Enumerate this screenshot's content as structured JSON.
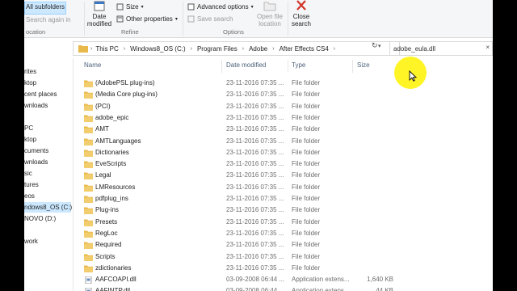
{
  "ribbon": {
    "all_subfolders": "All subfolders",
    "search_again_in": "Search again in",
    "location_group": "ocation",
    "date_modified": "Date\nmodified",
    "size": "Size",
    "other_properties": "Other properties",
    "refine_group": "Refine",
    "advanced_options": "Advanced options",
    "save_search": "Save search",
    "open_file_location": "Open file\nlocation",
    "options_group": "Options",
    "close_search": "Close\nsearch"
  },
  "address": {
    "crumbs": [
      "This PC",
      "Windows8_OS (C:)",
      "Program Files",
      "Adobe",
      "After Effects CS4"
    ],
    "search_value": "adobe_eula.dll"
  },
  "nav": {
    "items": [
      "rites",
      "ktop",
      "cent places",
      "wnloads",
      "PC",
      "ktop",
      "cuments",
      "wnloads",
      "sic",
      "tures",
      "eos",
      "ndows8_OS (C:)",
      "NOVO (D:)",
      "work"
    ]
  },
  "columns": {
    "name": "Name",
    "date": "Date modified",
    "type": "Type",
    "size": "Size"
  },
  "rows": [
    {
      "name": "(AdobePSL plug-ins)",
      "date": "23-11-2016 07:35 ...",
      "type": "File folder",
      "size": "",
      "icon": "folder-icon"
    },
    {
      "name": "(Media Core plug-ins)",
      "date": "23-11-2016 07:35 ...",
      "type": "File folder",
      "size": "",
      "icon": "folder-icon"
    },
    {
      "name": "(PCI)",
      "date": "23-11-2016 07:35 ...",
      "type": "File folder",
      "size": "",
      "icon": "folder-icon"
    },
    {
      "name": "adobe_epic",
      "date": "23-11-2016 07:35 ...",
      "type": "File folder",
      "size": "",
      "icon": "folder-icon"
    },
    {
      "name": "AMT",
      "date": "23-11-2016 07:35 ...",
      "type": "File folder",
      "size": "",
      "icon": "folder-icon"
    },
    {
      "name": "AMTLanguages",
      "date": "23-11-2016 07:35 ...",
      "type": "File folder",
      "size": "",
      "icon": "folder-icon"
    },
    {
      "name": "Dictionaries",
      "date": "23-11-2016 07:35 ...",
      "type": "File folder",
      "size": "",
      "icon": "folder-icon"
    },
    {
      "name": "EveScripts",
      "date": "23-11-2016 07:35 ...",
      "type": "File folder",
      "size": "",
      "icon": "folder-icon"
    },
    {
      "name": "Legal",
      "date": "23-11-2016 07:35 ...",
      "type": "File folder",
      "size": "",
      "icon": "folder-icon"
    },
    {
      "name": "LMResources",
      "date": "23-11-2016 07:35 ...",
      "type": "File folder",
      "size": "",
      "icon": "folder-icon"
    },
    {
      "name": "pdfplug_ins",
      "date": "23-11-2016 07:35 ...",
      "type": "File folder",
      "size": "",
      "icon": "folder-icon"
    },
    {
      "name": "Plug-ins",
      "date": "23-11-2016 07:35 ...",
      "type": "File folder",
      "size": "",
      "icon": "folder-icon"
    },
    {
      "name": "Presets",
      "date": "23-11-2016 07:35 ...",
      "type": "File folder",
      "size": "",
      "icon": "folder-icon"
    },
    {
      "name": "RegLoc",
      "date": "23-11-2016 07:35 ...",
      "type": "File folder",
      "size": "",
      "icon": "folder-icon"
    },
    {
      "name": "Required",
      "date": "23-11-2016 07:35 ...",
      "type": "File folder",
      "size": "",
      "icon": "folder-icon"
    },
    {
      "name": "Scripts",
      "date": "23-11-2016 07:35 ...",
      "type": "File folder",
      "size": "",
      "icon": "folder-icon"
    },
    {
      "name": "zdictionaries",
      "date": "23-11-2016 07:35 ...",
      "type": "File folder",
      "size": "",
      "icon": "folder-icon"
    },
    {
      "name": "AAFCOAPI.dll",
      "date": "03-09-2008 06:44 ...",
      "type": "Application extens...",
      "size": "1,640 KB",
      "icon": "dll-file-icon"
    },
    {
      "name": "AAFINTP.dll",
      "date": "03-09-2008 06:44 ...",
      "type": "Application extens...",
      "size": "44 KB",
      "icon": "dll-file-icon"
    }
  ],
  "colors": {
    "folder": "#e8b84a",
    "selection": "#cce8ff",
    "header_text": "#4c607a",
    "cursor_highlight": "#fff200"
  }
}
